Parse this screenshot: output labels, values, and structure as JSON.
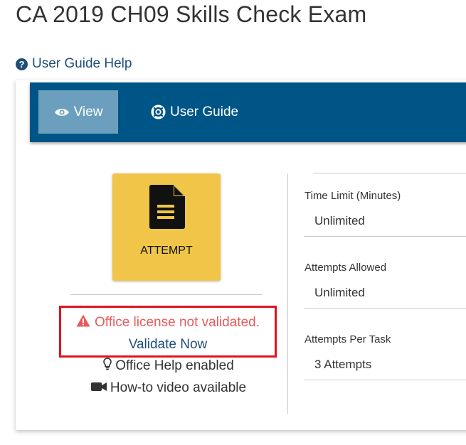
{
  "page": {
    "title": "CA 2019 CH09 Skills Check Exam",
    "help_link": "User Guide Help"
  },
  "nav": {
    "view_label": "View",
    "guide_label": "User Guide",
    "color": "#005587",
    "active_color": "#6b9fbd"
  },
  "attempt": {
    "label": "ATTEMPT",
    "color": "#f1c648"
  },
  "license": {
    "warning": "Office license not validated.",
    "validate_label": "Validate Now",
    "warning_color": "#e85a5a",
    "highlight_color": "#e0141e"
  },
  "features": {
    "office_help": "Office Help enabled",
    "howto_video": "How-to video available"
  },
  "stats": [
    {
      "label": "Time Limit (Minutes)",
      "value": "Unlimited"
    },
    {
      "label": "Attempts Allowed",
      "value": "Unlimited"
    },
    {
      "label": "Attempts Per Task",
      "value": "3 Attempts"
    }
  ]
}
